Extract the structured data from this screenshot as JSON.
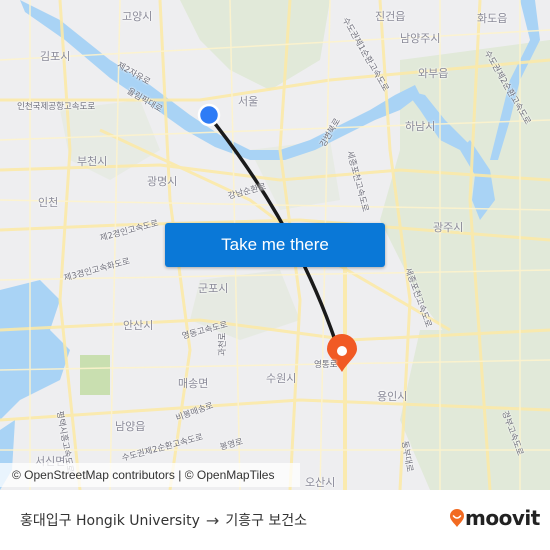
{
  "map": {
    "places": [
      {
        "name": "고양시"
      },
      {
        "name": "김포시"
      },
      {
        "name": "서울"
      },
      {
        "name": "부천시"
      },
      {
        "name": "광명시"
      },
      {
        "name": "인천"
      },
      {
        "name": "진건읍"
      },
      {
        "name": "화도읍"
      },
      {
        "name": "남양주시"
      },
      {
        "name": "와부읍"
      },
      {
        "name": "하남시"
      },
      {
        "name": "광주시"
      },
      {
        "name": "군포시"
      },
      {
        "name": "안산시"
      },
      {
        "name": "매송면"
      },
      {
        "name": "수원시"
      },
      {
        "name": "용인시"
      },
      {
        "name": "남양읍"
      },
      {
        "name": "서신면"
      },
      {
        "name": "오산시"
      }
    ],
    "roads": [
      {
        "name": "제2자유로"
      },
      {
        "name": "올림픽대로"
      },
      {
        "name": "인천국제공항고속도로"
      },
      {
        "name": "강남순환로"
      },
      {
        "name": "제2경인고속도로"
      },
      {
        "name": "제3경인고속화도로"
      },
      {
        "name": "영동고속도로"
      },
      {
        "name": "과천로"
      },
      {
        "name": "비봉매송로"
      },
      {
        "name": "수도권제2순환고속도로"
      },
      {
        "name": "봉영로"
      },
      {
        "name": "평택시흥고속도로"
      },
      {
        "name": "세종포천고속도로"
      },
      {
        "name": "강변북로"
      },
      {
        "name": "수도권제1순환고속도로"
      },
      {
        "name": "수도권제2순환고속도로"
      },
      {
        "name": "영동고속도로"
      },
      {
        "name": "세종포천고속도로"
      },
      {
        "name": "동부대로"
      },
      {
        "name": "경부고속도로"
      },
      {
        "name": "영통로"
      }
    ],
    "origin_marker": {
      "label": "홍대입구 Hongik University",
      "color": "#2e7cf6"
    },
    "destination_marker": {
      "label": "기흥구 보건소",
      "color": "#f15a24"
    },
    "route_line_color": "#1a1a1a",
    "cta_button": "Take me there",
    "attribution": "© OpenStreetMap contributors | © OpenMapTiles"
  },
  "footer": {
    "origin": "홍대입구 Hongik University",
    "arrow": "→",
    "destination": "기흥구 보건소",
    "logo_text": "moovit",
    "logo_color": "#f26a21"
  }
}
